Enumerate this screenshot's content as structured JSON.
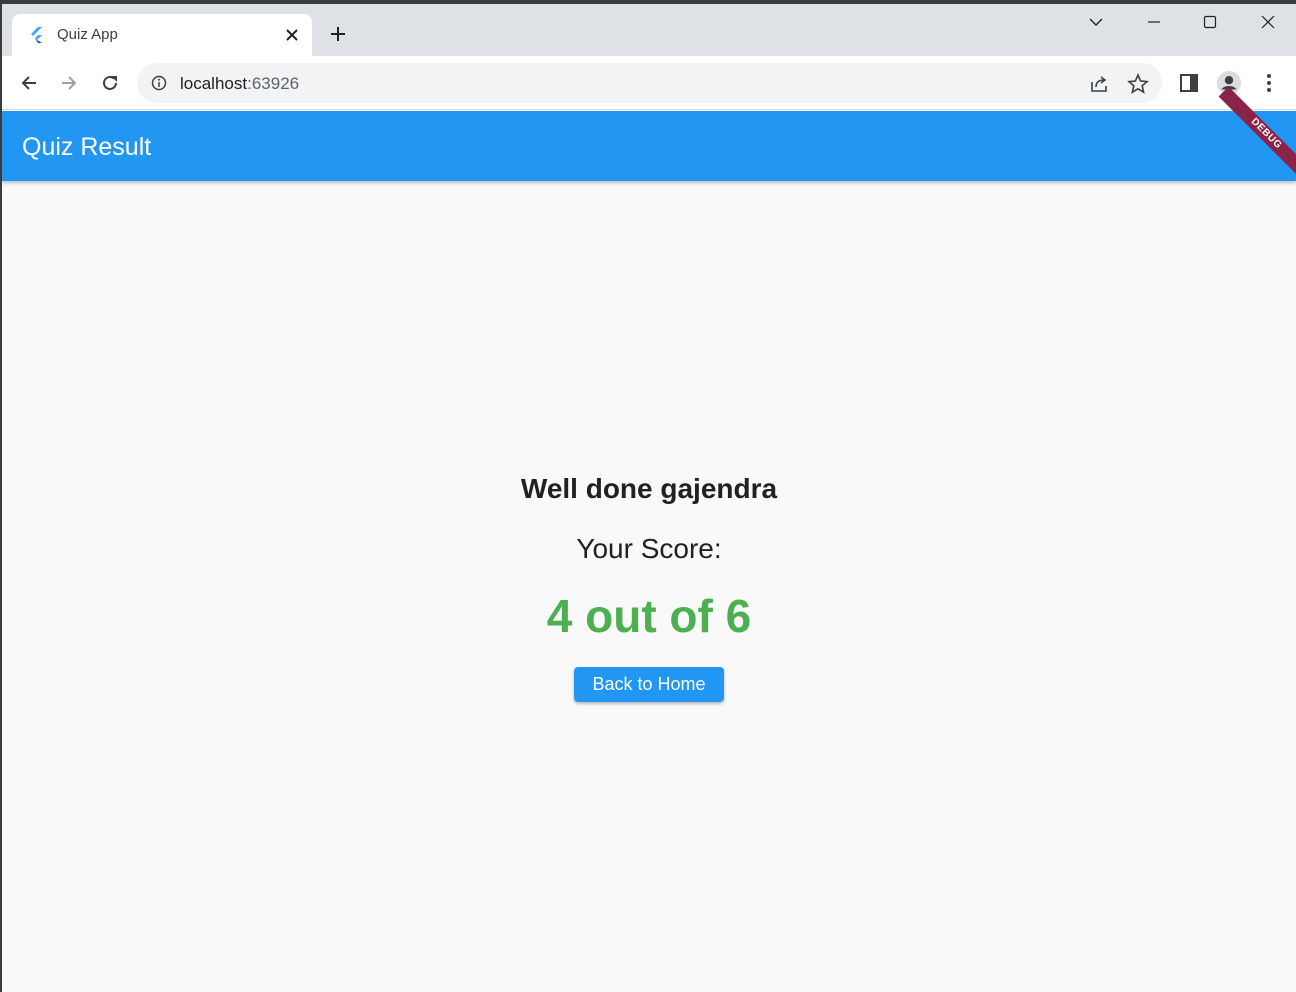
{
  "browser": {
    "tab_title": "Quiz App",
    "url_host": "localhost",
    "url_port": ":63926"
  },
  "app": {
    "appbar_title": "Quiz Result",
    "debug_banner": "DEBUG",
    "greeting": "Well done gajendra",
    "score_label": "Your Score:",
    "score_value": "4 out of 6",
    "back_button": "Back to Home"
  },
  "colors": {
    "appbar": "#2196f3",
    "score": "#4caf50",
    "debug": "#8b2248"
  },
  "icons": [
    "flutter-logo-icon",
    "close-icon",
    "plus-icon",
    "chevron-down-icon",
    "minimize-icon",
    "maximize-icon",
    "close-window-icon",
    "back-arrow-icon",
    "forward-arrow-icon",
    "reload-icon",
    "info-icon",
    "share-icon",
    "star-icon",
    "side-panel-icon",
    "profile-icon",
    "kebab-menu-icon"
  ]
}
